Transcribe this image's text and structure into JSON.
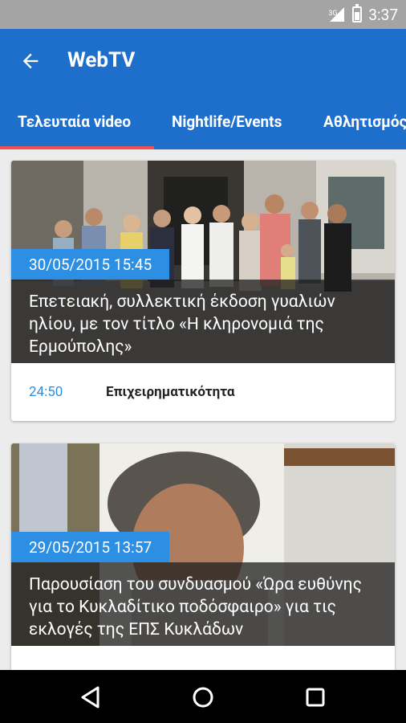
{
  "status_bar": {
    "network": "3G",
    "time": "3:37"
  },
  "app_bar": {
    "title": "WebTV",
    "back_icon": "arrow-back-icon"
  },
  "tabs": [
    {
      "label": "Τελευταία video",
      "selected": true
    },
    {
      "label": "Nightlife/Events",
      "selected": false
    },
    {
      "label": "Αθλητισμός",
      "selected": false
    }
  ],
  "colors": {
    "primary": "#1e6fcb",
    "accent_badge": "#2d8fe3",
    "tab_indicator": "#f04f55"
  },
  "videos": [
    {
      "date": "30/05/2015 15:45",
      "title": "Επετειακή, συλλεκτική έκδοση γυαλιών ηλίου, με τον τίτλο «Η κληρονομιά της Ερμούπολης»",
      "duration": "24:50",
      "category": "Επιχειρηματικότητα"
    },
    {
      "date": "29/05/2015 13:57",
      "title": "Παρουσίαση του συνδυασμού «Ώρα ευθύνης για το Κυκλαδίτικο ποδόσφαιρο» για τις εκλογές της ΕΠΣ Κυκλάδων",
      "duration": "",
      "category": ""
    }
  ],
  "nav_bar": {
    "icons": [
      "back-triangle-icon",
      "home-circle-icon",
      "recents-square-icon"
    ]
  }
}
